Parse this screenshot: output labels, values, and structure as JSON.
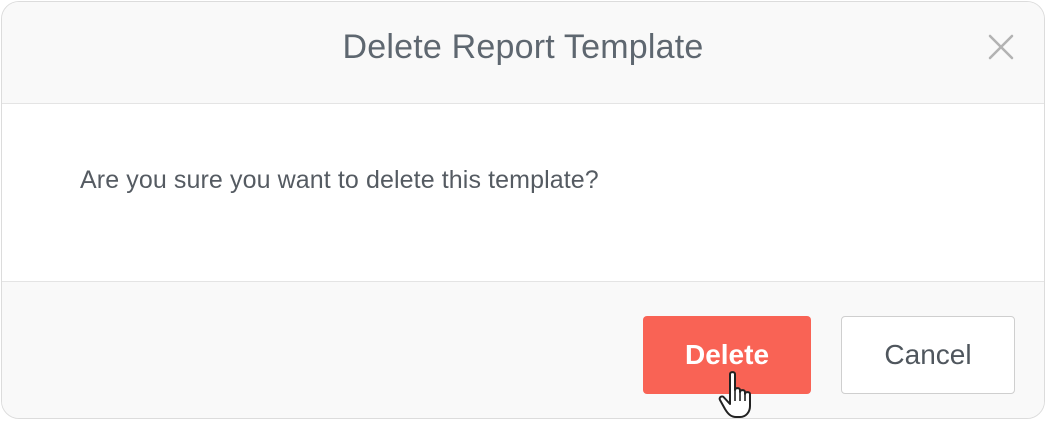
{
  "dialog": {
    "title": "Delete Report Template",
    "message": "Are you sure you want to delete this template?",
    "close_icon": "close-icon",
    "buttons": {
      "delete_label": "Delete",
      "cancel_label": "Cancel"
    }
  },
  "colors": {
    "delete_button": "#f96355",
    "title_text": "#5e6770",
    "header_bg": "#f9f9f9"
  },
  "cursor": "hand-pointer-icon"
}
